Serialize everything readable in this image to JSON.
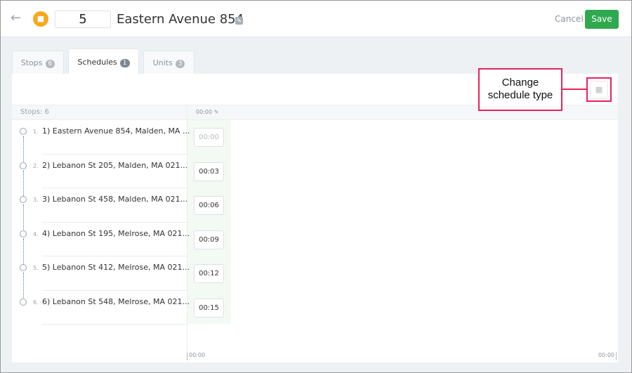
{
  "header": {
    "route_number": "5",
    "title": "Eastern Avenue 854",
    "cancel_label": "Cancel",
    "save_label": "Save"
  },
  "tabs": [
    {
      "label": "Stops",
      "count": "6"
    },
    {
      "label": "Schedules",
      "count": "1"
    },
    {
      "label": "Units",
      "count": "3"
    }
  ],
  "schedule": {
    "stops_header": "Stops: 6",
    "time_header": "00:00",
    "stops": [
      {
        "index": "1.",
        "address": "1) Eastern Avenue 854, Malden, MA ...",
        "time": "00:00"
      },
      {
        "index": "2.",
        "address": "2) Lebanon St 205, Malden, MA 021...",
        "time": "00:03"
      },
      {
        "index": "3.",
        "address": "3) Lebanon St 458, Malden, MA 021...",
        "time": "00:06"
      },
      {
        "index": "4.",
        "address": "4) Lebanon St 195, Melrose, MA 021...",
        "time": "00:09"
      },
      {
        "index": "5.",
        "address": "5) Lebanon St 412, Melrose, MA 021...",
        "time": "00:12"
      },
      {
        "index": "6.",
        "address": "6) Lebanon St 548, Melrose, MA 021...",
        "time": "00:15"
      }
    ],
    "axis_start": "00:00",
    "axis_end": "00:00"
  },
  "callout": {
    "text": "Change schedule type"
  }
}
